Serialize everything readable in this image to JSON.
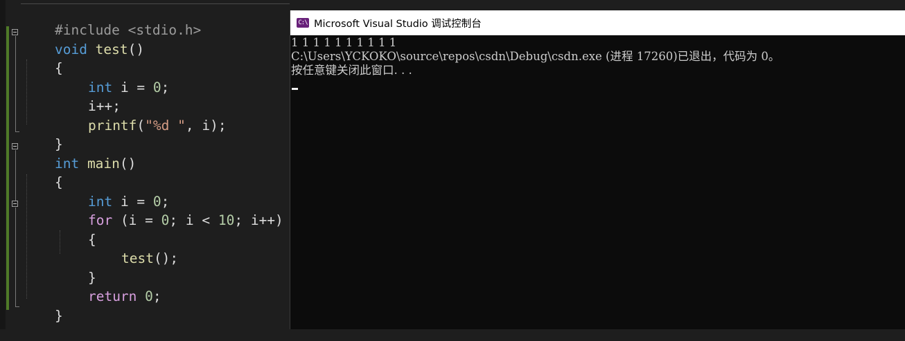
{
  "editor": {
    "line1": {
      "pre": "#include <stdio.h>"
    },
    "line2": {
      "kw": "void",
      "name": " test",
      "rest": "()"
    },
    "line3": {
      "brace": "{"
    },
    "line4": {
      "kw": "int",
      "rest": " i = ",
      "num": "0",
      "end": ";"
    },
    "line5": {
      "text": "i++;"
    },
    "line6": {
      "fn": "printf",
      "open": "(",
      "str": "\"%d \"",
      "rest": ", i);"
    },
    "line7": {
      "brace": "}"
    },
    "line8": {
      "kw": "int",
      "name": " main",
      "rest": "()"
    },
    "line9": {
      "brace": "{"
    },
    "line10": {
      "kw": "int",
      "rest": " i = ",
      "num": "0",
      "end": ";"
    },
    "line11": {
      "ctrl": "for",
      "a": " (i = ",
      "n1": "0",
      "b": "; i < ",
      "n2": "10",
      "c": "; i++)"
    },
    "line12": {
      "brace": "{"
    },
    "line13": {
      "fn": "test",
      "rest": "();"
    },
    "line14": {
      "brace": "}"
    },
    "line15": {
      "ctrl": "return",
      "sp": " ",
      "num": "0",
      "end": ";"
    },
    "line16": {
      "brace": "}"
    }
  },
  "console": {
    "icon_text": "C:\\",
    "title": "Microsoft Visual Studio 调试控制台",
    "output": [
      "1 1 1 1 1 1 1 1 1 1",
      "C:\\Users\\YCKOKO\\source\\repos\\csdn\\Debug\\csdn.exe (进程 17260)已退出，代码为 0。",
      "按任意键关闭此窗口. . ."
    ]
  },
  "colors": {
    "keyword": "#569cd6",
    "control": "#d8a0df",
    "function": "#dcdcaa",
    "string": "#d69d85",
    "number": "#b5cea8",
    "preprocessor": "#9b9b9b",
    "console_bg": "#0c0c0c",
    "change_bar": "#4f7a28"
  }
}
